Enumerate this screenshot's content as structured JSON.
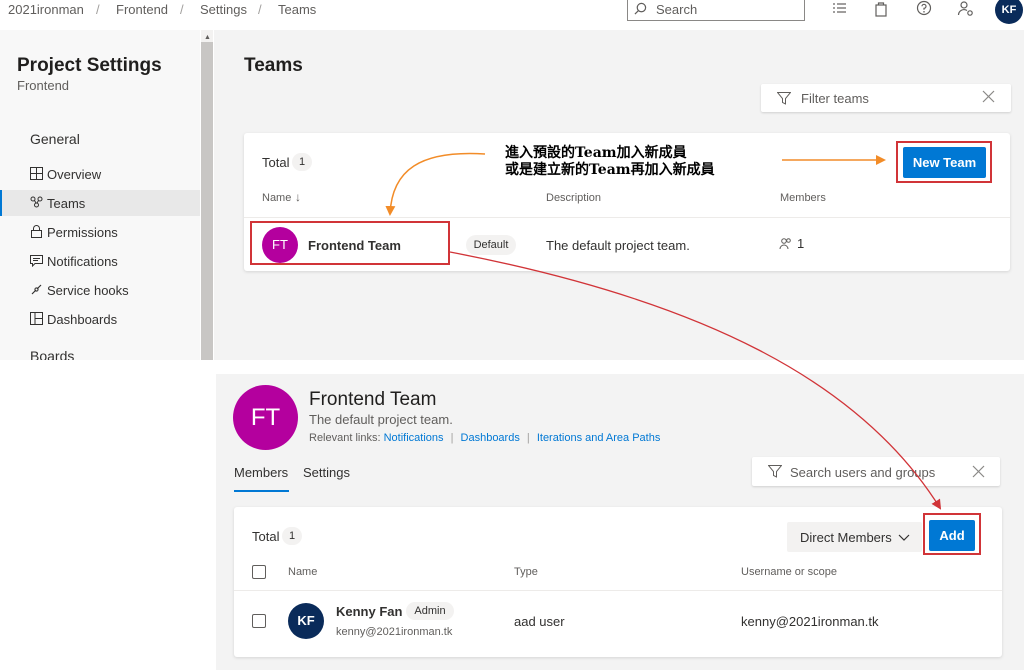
{
  "breadcrumb": {
    "org": "2021ironman",
    "project": "Frontend",
    "section": "Settings",
    "page": "Teams",
    "sep": "/"
  },
  "topbar": {
    "search_placeholder": "Search",
    "user_initials": "KF"
  },
  "sidebar": {
    "title": "Project Settings",
    "subtitle": "Frontend",
    "general_label": "General",
    "boards_label": "Boards",
    "items": [
      {
        "label": "Overview",
        "icon": "overview-icon"
      },
      {
        "label": "Teams",
        "icon": "teams-icon",
        "active": true
      },
      {
        "label": "Permissions",
        "icon": "lock-icon"
      },
      {
        "label": "Notifications",
        "icon": "notification-icon"
      },
      {
        "label": "Service hooks",
        "icon": "service-hooks-icon"
      },
      {
        "label": "Dashboards",
        "icon": "dashboard-icon"
      }
    ]
  },
  "teams_page": {
    "title": "Teams",
    "filter_placeholder": "Filter teams",
    "total_label": "Total",
    "total_count": "1",
    "new_team_label": "New Team",
    "columns": {
      "name": "Name",
      "sort_arrow": "↓",
      "description": "Description",
      "members": "Members"
    },
    "rows": [
      {
        "initials": "FT",
        "name": "Frontend Team",
        "badge": "Default",
        "description": "The default project team.",
        "members": "1"
      }
    ]
  },
  "annotation": {
    "line1": "進入預設的Team加入新成員",
    "line2": "或是建立新的Team再加入新成員"
  },
  "team_detail": {
    "initials": "FT",
    "name": "Frontend Team",
    "description": "The default project team.",
    "relevant_label": "Relevant links:",
    "links": [
      "Notifications",
      "Dashboards",
      "Iterations and Area Paths"
    ],
    "link_sep": "|",
    "tabs": [
      "Members",
      "Settings"
    ],
    "search_placeholder": "Search users and groups",
    "total_label": "Total",
    "total_count": "1",
    "direct_members_label": "Direct Members",
    "add_label": "Add",
    "columns": {
      "name": "Name",
      "type": "Type",
      "username": "Username or scope"
    },
    "members": [
      {
        "initials": "KF",
        "name": "Kenny Fan",
        "badge": "Admin",
        "email": "kenny@2021ironman.tk",
        "type": "aad user",
        "username": "kenny@2021ironman.tk"
      }
    ]
  },
  "colors": {
    "accent": "#0078d4",
    "annotation_red": "#d13438",
    "arrow_orange": "#f28c28",
    "team_avatar": "#b4009e",
    "user_avatar": "#0a2b5a"
  }
}
